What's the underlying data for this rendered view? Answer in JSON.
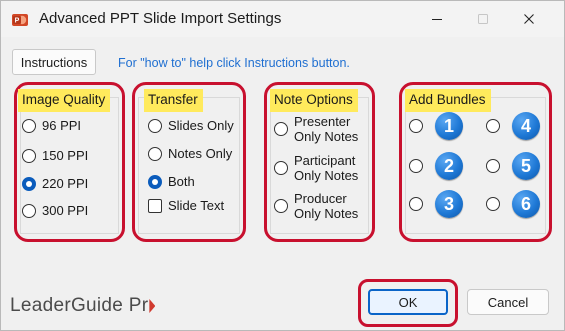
{
  "window": {
    "title": "Advanced PPT Slide Import Settings",
    "icon": "powerpoint-icon",
    "minimize_icon": "minimize-icon",
    "maximize_icon": "maximize-icon",
    "close_icon": "close-icon"
  },
  "instructions": {
    "button_label": "Instructions"
  },
  "help_text": "For \"how to\" help click Instructions button.",
  "image_quality": {
    "label": "Image Quality",
    "options": [
      {
        "label": "96 PPI",
        "checked": false
      },
      {
        "label": "150 PPI",
        "checked": false
      },
      {
        "label": "220 PPI",
        "checked": true
      },
      {
        "label": "300 PPI",
        "checked": false
      }
    ]
  },
  "transfer": {
    "label": "Transfer",
    "options": [
      {
        "label": "Slides Only",
        "checked": false
      },
      {
        "label": "Notes Only",
        "checked": false
      },
      {
        "label": "Both",
        "checked": true
      }
    ],
    "checkbox": {
      "label": "Slide Text",
      "checked": false
    }
  },
  "note_options": {
    "label": "Note Options",
    "options": [
      {
        "line1": "Presenter",
        "line2": "Only Notes",
        "checked": false
      },
      {
        "line1": "Participant",
        "line2": "Only Notes",
        "checked": false
      },
      {
        "line1": "Producer",
        "line2": "Only Notes",
        "checked": false
      }
    ]
  },
  "add_bundles": {
    "label": "Add Bundles",
    "bundles": [
      {
        "number": "1",
        "checked": false
      },
      {
        "number": "2",
        "checked": false
      },
      {
        "number": "3",
        "checked": false
      },
      {
        "number": "4",
        "checked": false
      },
      {
        "number": "5",
        "checked": false
      },
      {
        "number": "6",
        "checked": false
      }
    ]
  },
  "logo": {
    "text_main": "LeaderGuide Pr"
  },
  "buttons": {
    "ok": "OK",
    "cancel": "Cancel"
  },
  "colors": {
    "highlight_yellow": "#ffea5c",
    "annotation_red": "#c8102e",
    "accent_blue": "#0b5cbc",
    "link_blue": "#1f6fd1"
  }
}
